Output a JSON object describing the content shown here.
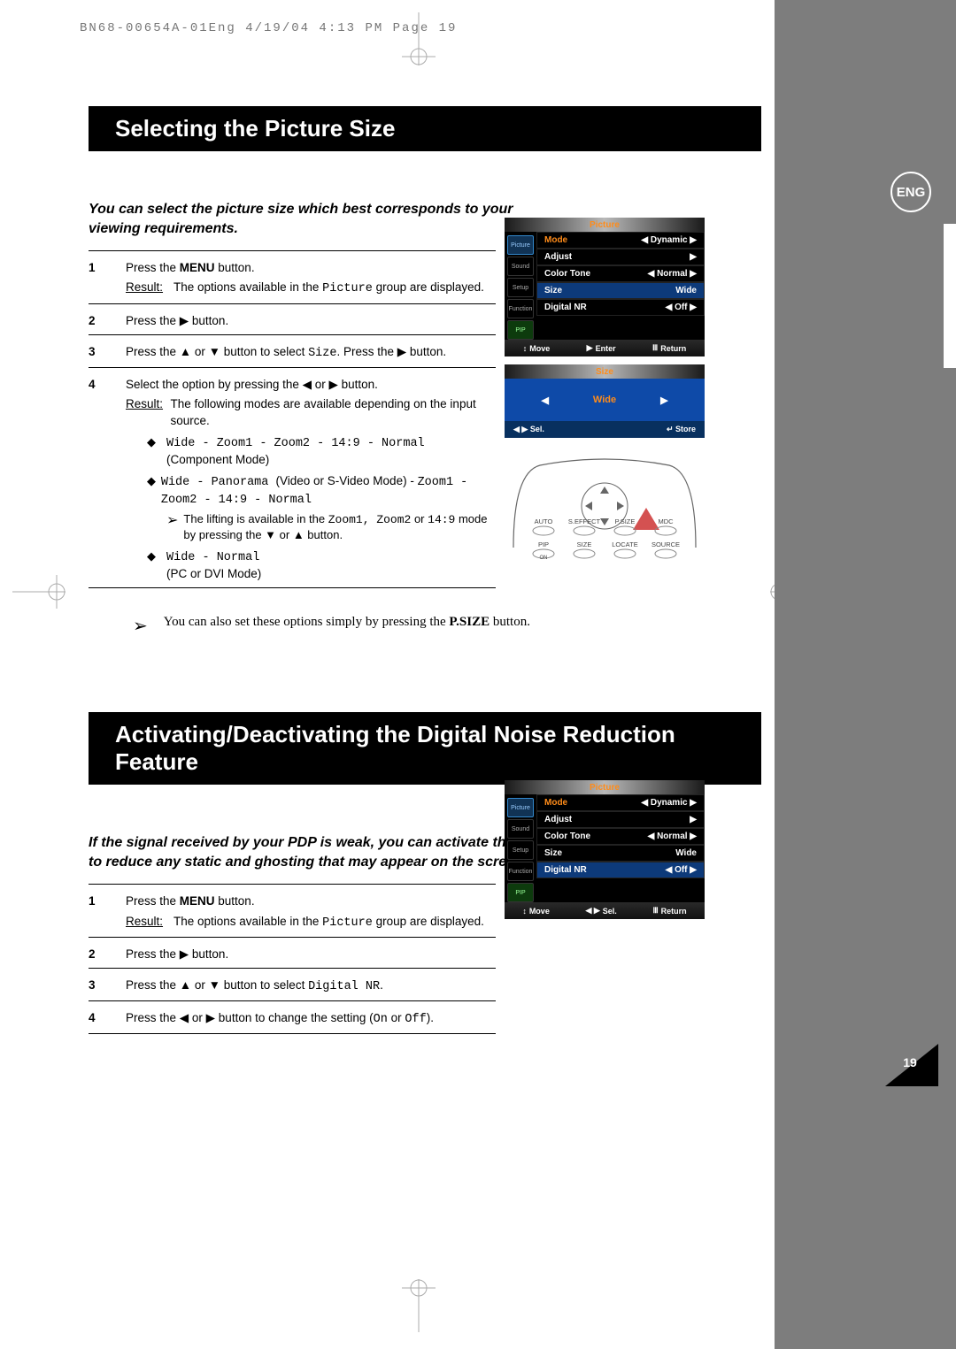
{
  "header_line": "BN68-00654A-01Eng  4/19/04  4:13 PM  Page 19",
  "lang_badge": "ENG",
  "page_number": "19",
  "section1": {
    "title": "Selecting the Picture Size",
    "intro": "You can select the picture size which best corresponds to your viewing requirements.",
    "steps": [
      {
        "n": "1",
        "text_pre": "Press the ",
        "bold": "MENU",
        "text_post": " button.",
        "result": "The options available in the ",
        "result_mono": "Picture",
        "result_tail": " group are displayed."
      },
      {
        "n": "2",
        "text": "Press the ▶ button."
      },
      {
        "n": "3",
        "text_pre": "Press the ▲ or ▼ button to select ",
        "mono": "Size",
        "text_post": ". Press the ▶ button."
      },
      {
        "n": "4",
        "text": "Select the option by pressing the ◀ or ▶ button.",
        "result": "The following modes are available depending on the input source.",
        "bullets": [
          {
            "mono": "Wide - Zoom1 - Zoom2 - 14:9 - Normal",
            "sub": "(Component Mode)"
          },
          {
            "mono_pre": "Wide - Panorama ",
            "plain_mid": "(Video or S-Video Mode) - ",
            "mono_post": "Zoom1 - Zoom2 - 14:9 - Normal",
            "note_pre": "The lifting is available in the ",
            "note_mono": "Zoom1, Zoom2",
            "note_mid": " or ",
            "note_mono2": "14:9",
            "note_post": " mode by pressing the ▼ or ▲ button."
          },
          {
            "mono": "Wide - Normal",
            "sub": "(PC or DVI Mode)"
          }
        ]
      }
    ],
    "tip_pre": "You can also set these options simply by pressing the ",
    "tip_bold": "P.SIZE",
    "tip_post": " button."
  },
  "section2": {
    "title": "Activating/Deactivating the Digital Noise Reduction Feature",
    "intro": "If the signal received by your PDP is weak, you can activate this feature to reduce any static and ghosting that may appear on the screen.",
    "steps": [
      {
        "n": "1",
        "text_pre": "Press the ",
        "bold": "MENU",
        "text_post": " button.",
        "result": "The options available in the ",
        "result_mono": "Picture",
        "result_tail": " group are displayed."
      },
      {
        "n": "2",
        "text": "Press the ▶ button."
      },
      {
        "n": "3",
        "text_pre": "Press the ▲ or ▼ button to select ",
        "mono": "Digital NR",
        "text_post": "."
      },
      {
        "n": "4",
        "text_pre": "Press the ◀ or ▶ button to change the setting (",
        "mono": "On",
        "text_mid": " or ",
        "mono2": "Off",
        "text_post": ")."
      }
    ]
  },
  "osd1": {
    "title": "Picture",
    "tabs": [
      "Picture",
      "Sound",
      "Setup",
      "Function",
      "PIP"
    ],
    "rows": [
      {
        "l": "Mode",
        "r": "◀  Dynamic  ▶",
        "orange": true
      },
      {
        "l": "Adjust",
        "r": "▶"
      },
      {
        "l": "Color Tone",
        "r": "◀  Normal  ▶"
      },
      {
        "l": "Size",
        "r": "Wide",
        "sel": true
      },
      {
        "l": "Digital NR",
        "r": "◀  Off  ▶"
      }
    ],
    "foot": {
      "a": "Move",
      "b": "Enter",
      "c": "Return",
      "arrow_a": "↕",
      "arrow_b": "▶",
      "arrow_c": "Ⅲ"
    }
  },
  "osd_size": {
    "title": "Size",
    "value": "Wide",
    "sel": "◀ ▶ Sel.",
    "store": "↵ Store"
  },
  "remote": {
    "labels": [
      "AUTO",
      "S.EFFECT",
      "P.SIZE",
      "MDC",
      "PIP",
      "SIZE",
      "LOCATE",
      "SOURCE",
      "ON"
    ]
  },
  "osd2": {
    "title": "Picture",
    "tabs": [
      "Picture",
      "Sound",
      "Setup",
      "Function",
      "PIP"
    ],
    "rows": [
      {
        "l": "Mode",
        "r": "◀  Dynamic  ▶",
        "orange": true
      },
      {
        "l": "Adjust",
        "r": "▶"
      },
      {
        "l": "Color Tone",
        "r": "◀  Normal  ▶"
      },
      {
        "l": "Size",
        "r": "Wide"
      },
      {
        "l": "Digital NR",
        "r": "◀  Off  ▶",
        "sel": true
      }
    ],
    "foot": {
      "a": "Move",
      "b": "Sel.",
      "c": "Return",
      "arrow_a": "↕",
      "arrow_b": "◀ ▶",
      "arrow_c": "Ⅲ"
    }
  }
}
